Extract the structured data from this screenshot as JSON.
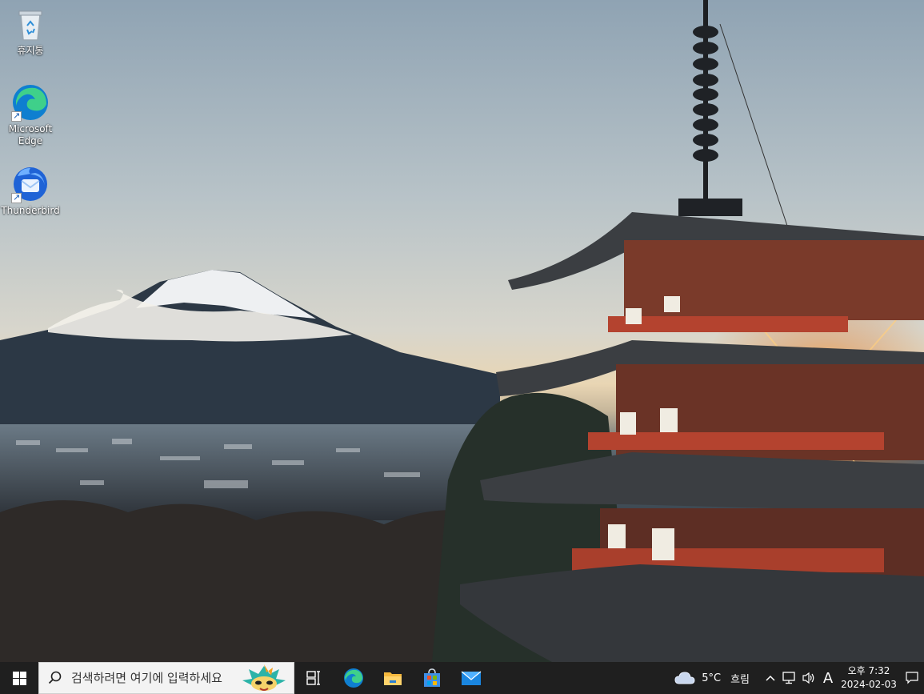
{
  "desktop": {
    "icons": [
      {
        "label": "휴지통",
        "icon": "recycle-bin-icon"
      },
      {
        "label": "Microsoft Edge",
        "icon": "edge-icon"
      },
      {
        "label": "Thunderbird",
        "icon": "thunderbird-icon"
      }
    ]
  },
  "taskbar": {
    "search_placeholder": "검색하려면 여기에 입력하세요",
    "apps": [
      "task-view-icon",
      "edge-icon",
      "file-explorer-icon",
      "microsoft-store-icon",
      "mail-icon"
    ],
    "weather": {
      "temp": "5°C",
      "condition": "흐림"
    },
    "ime": "A",
    "clock": {
      "time": "오후 7:32",
      "date": "2024-02-03"
    }
  },
  "colors": {
    "taskbar_bg": "#1f1f1f",
    "search_bg": "#f3f3f3",
    "windows_blue": "#0078d4"
  }
}
